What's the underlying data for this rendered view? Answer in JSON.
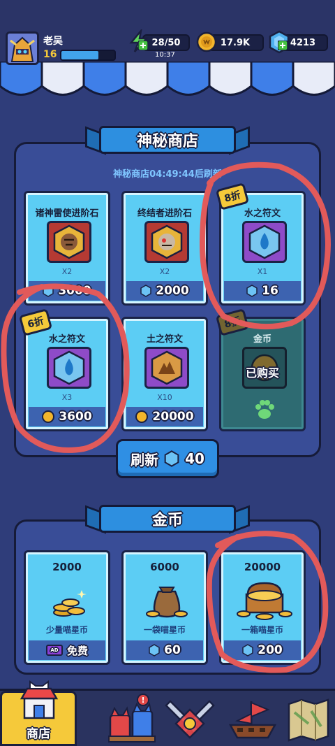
{
  "player": {
    "name": "老吴",
    "level": "16",
    "xp_fraction": 0.7,
    "avatar_icon": "knight-avatar-icon"
  },
  "resources": {
    "energy": "28/50",
    "energy_timer": "10:37",
    "coins": "17.9K",
    "gems": "4213"
  },
  "mystery_shop": {
    "title": "神秘商店",
    "timer_text": "神秘商店04:49:44后刷新",
    "items": [
      {
        "name": "诸神雷使进阶石",
        "qty": "X2",
        "price": "3000",
        "currency": "gem"
      },
      {
        "name": "终结者进阶石",
        "qty": "X2",
        "price": "2000",
        "currency": "gem"
      },
      {
        "name": "水之符文",
        "qty": "X1",
        "price": "16",
        "currency": "gem",
        "badge": "8折"
      },
      {
        "name": "水之符文",
        "qty": "X3",
        "price": "3600",
        "currency": "coin",
        "badge": "6折"
      },
      {
        "name": "土之符文",
        "qty": "X10",
        "price": "20000",
        "currency": "coin"
      },
      {
        "name": "金币",
        "qty": "",
        "price": "",
        "currency": "",
        "badge": "8折",
        "sold_out_text": "已购买"
      }
    ],
    "refresh_label": "刷新",
    "refresh_cost": "40"
  },
  "gold_shop": {
    "title": "金币",
    "packs": [
      {
        "amount": "2000",
        "name": "少量喵星币",
        "price": "免费",
        "ad_label": "AD"
      },
      {
        "amount": "6000",
        "name": "一袋喵星币",
        "price": "60"
      },
      {
        "amount": "20000",
        "name": "一箱喵星币",
        "price": "200"
      }
    ]
  },
  "nav": {
    "items": [
      {
        "label": "商店",
        "icon": "shop-icon",
        "active": true
      },
      {
        "label": "",
        "icon": "cats-team-icon",
        "alert": "!"
      },
      {
        "label": "",
        "icon": "crossed-swords-icon"
      },
      {
        "label": "",
        "icon": "ship-icon"
      },
      {
        "label": "",
        "icon": "map-icon"
      }
    ]
  },
  "colors": {
    "background": "#2f3d7a",
    "card": "#5ccdf4",
    "accent_blue": "#2d8fe0",
    "badge_yellow": "#f5c93a",
    "annotation_red": "#e25a5a"
  }
}
